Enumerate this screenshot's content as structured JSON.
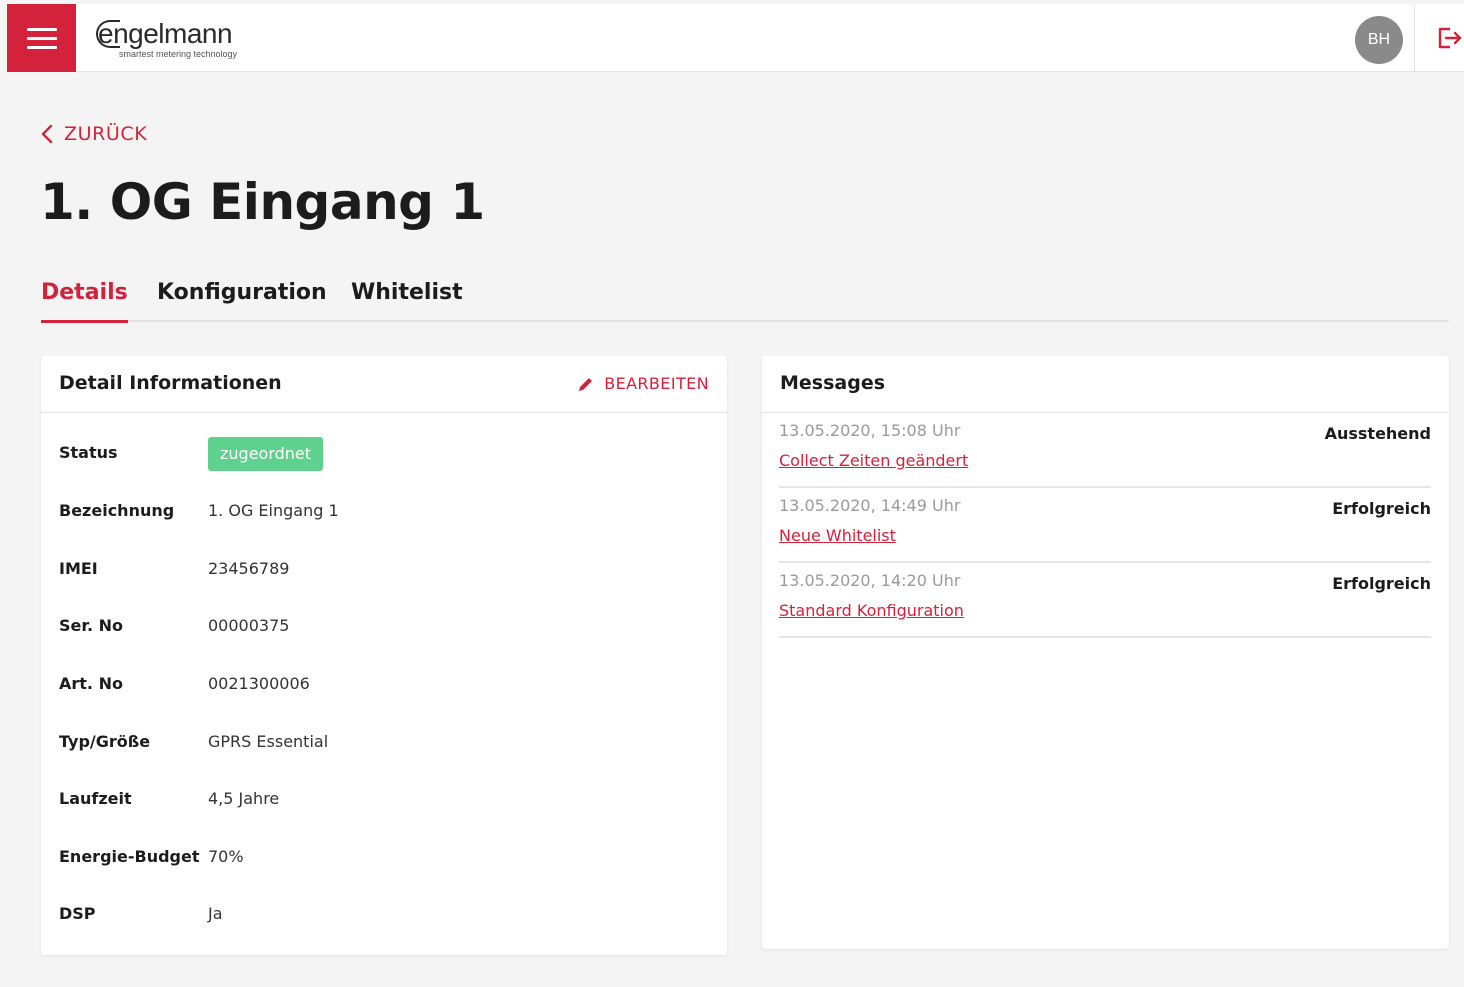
{
  "header": {
    "logo_word": "engelmann",
    "logo_tagline": "smartest metering technology",
    "avatar_initials": "BH",
    "accent_color": "#d5223c"
  },
  "nav": {
    "back_label": "ZURÜCK"
  },
  "page": {
    "title": "1. OG Eingang 1"
  },
  "tabs": [
    {
      "label": "Details",
      "active": true
    },
    {
      "label": "Konfiguration",
      "active": false
    },
    {
      "label": "Whitelist",
      "active": false
    }
  ],
  "details": {
    "title": "Detail Informationen",
    "edit_label": "BEARBEITEN",
    "status_label": "Status",
    "status_value": "zugeordnet",
    "status_color": "#5fd18e",
    "rows": [
      {
        "label": "Bezeichnung",
        "value": "1. OG Eingang 1"
      },
      {
        "label": "IMEI",
        "value": "23456789"
      },
      {
        "label": "Ser. No",
        "value": "00000375"
      },
      {
        "label": "Art. No",
        "value": "0021300006"
      },
      {
        "label": "Typ/Größe",
        "value": "GPRS Essential"
      },
      {
        "label": "Laufzeit",
        "value": "4,5 Jahre"
      },
      {
        "label": "Energie-Budget",
        "value": "70%"
      },
      {
        "label": "DSP",
        "value": "Ja"
      }
    ]
  },
  "messages": {
    "title": "Messages",
    "items": [
      {
        "time": "13.05.2020, 15:08 Uhr",
        "link": "Collect Zeiten geändert",
        "state": "Ausstehend"
      },
      {
        "time": "13.05.2020, 14:49 Uhr",
        "link": "Neue Whitelist",
        "state": "Erfolgreich"
      },
      {
        "time": "13.05.2020, 14:20 Uhr",
        "link": "Standard Konfiguration",
        "state": "Erfolgreich"
      }
    ]
  }
}
